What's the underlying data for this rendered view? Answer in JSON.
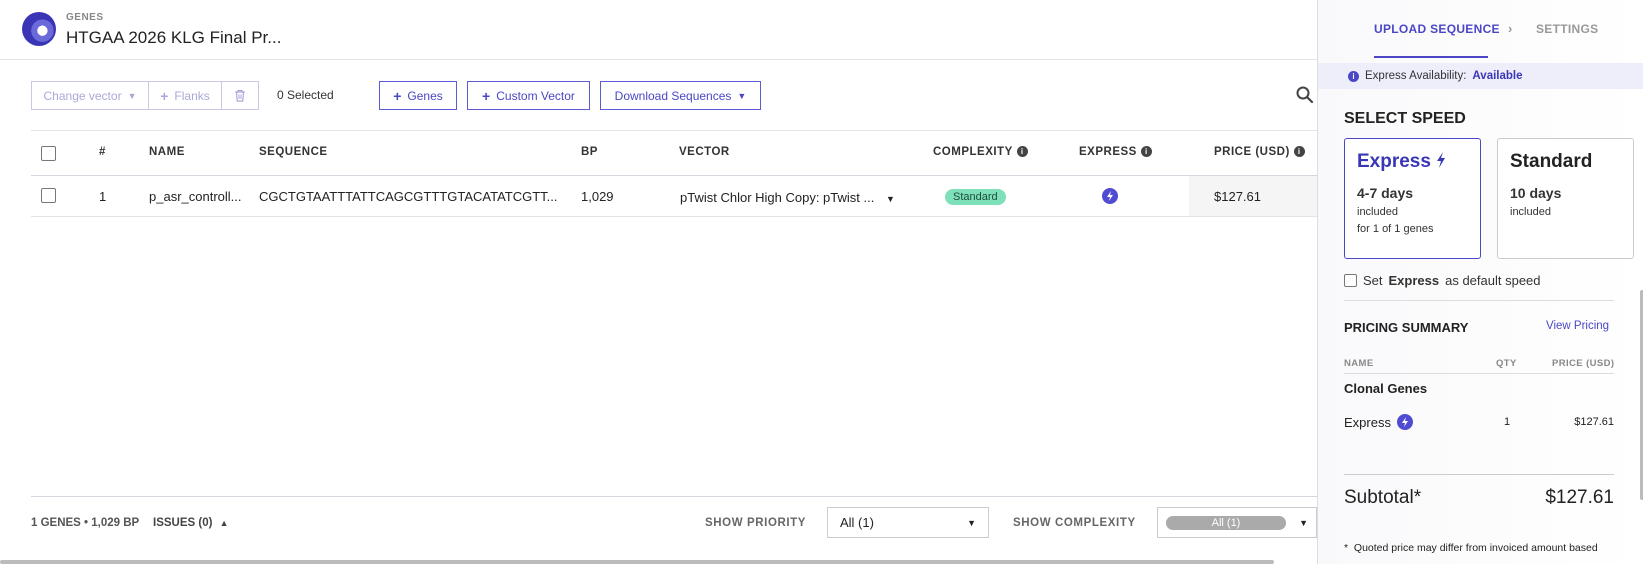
{
  "header": {
    "kicker": "GENES",
    "title": "HTGAA 2026 KLG Final Pr..."
  },
  "toolbar": {
    "change_vector": "Change vector",
    "flanks": "Flanks",
    "selected": "0 Selected",
    "genes": "Genes",
    "custom_vector": "Custom Vector",
    "download": "Download Sequences"
  },
  "table": {
    "headers": {
      "num": "#",
      "name": "NAME",
      "sequence": "SEQUENCE",
      "bp": "BP",
      "vector": "VECTOR",
      "complexity": "COMPLEXITY",
      "express": "EXPRESS",
      "price": "PRICE (USD)"
    },
    "rows": [
      {
        "num": "1",
        "name": "p_asr_controll...",
        "sequence": "CGCTGTAATTTATTCAGCGTTTGTACATATCGTT...",
        "bp": "1,029",
        "vector": "pTwist Chlor High Copy: pTwist ...",
        "complexity": "Standard",
        "price": "$127.61"
      }
    ]
  },
  "footer": {
    "summary": "1 GENES • 1,029 BP",
    "issues": "ISSUES (0)",
    "show_priority": "SHOW PRIORITY",
    "priority_value": "All (1)",
    "show_complexity": "SHOW COMPLEXITY",
    "complexity_value": "All (1)"
  },
  "panel": {
    "tab_upload": "UPLOAD SEQUENCE",
    "tab_settings": "SETTINGS",
    "avail_label": "Express Availability:",
    "avail_value": "Available",
    "select_speed": "SELECT SPEED",
    "express": {
      "name": "Express",
      "days": "4-7 days",
      "included": "included",
      "note": "for 1 of 1 genes"
    },
    "standard": {
      "name": "Standard",
      "days": "10 days",
      "included": "included"
    },
    "default_prefix": "Set",
    "default_bold": "Express",
    "default_suffix": "as default speed",
    "pricing_summary": "PRICING SUMMARY",
    "view_pricing": "View Pricing",
    "col_name": "NAME",
    "col_qty": "QTY",
    "col_price": "PRICE (USD)",
    "group": "Clonal Genes",
    "line_item": {
      "name": "Express",
      "qty": "1",
      "price": "$127.61"
    },
    "subtotal_label": "Subtotal*",
    "subtotal_value": "$127.61",
    "disclaimer": "Quoted price may differ from invoiced amount based"
  },
  "colors": {
    "accent": "#4a47c6",
    "badge": "#7ee0b8"
  }
}
